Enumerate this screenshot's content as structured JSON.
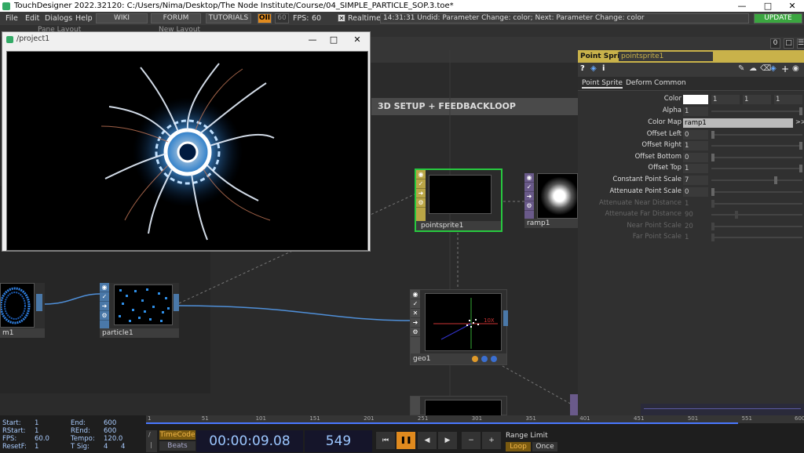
{
  "window": {
    "title": "TouchDesigner 2022.32120: C:/Users/Nima/Desktop/The Node Institute/Course/04_SIMPLE_PARTICLE_SOP.3.toe*"
  },
  "menu": {
    "items": [
      "File",
      "Edit",
      "Dialogs",
      "Help"
    ],
    "wiki": "WIKI",
    "forum": "FORUM",
    "tutorials": "TUTORIALS",
    "perf": "OII",
    "fps_target": "60",
    "fps_label": "FPS:",
    "fps_value": "60",
    "realtime": "Realtime",
    "status": "14:31:31 Undid: Parameter Change: color; Next: Parameter Change: color",
    "update": "UPDATE"
  },
  "toolbar": {
    "pane_layout": "Pane Layout",
    "new_layout": "New Layout",
    "num_zero": "0"
  },
  "floating_window": {
    "title": "/project1"
  },
  "network": {
    "annotation": "3D SETUP + FEEDBACKLOOP",
    "nodes": {
      "pointsprite": "pointsprite1",
      "ramp": "ramp1",
      "particle": "particle1",
      "circle": "m1",
      "geo": "geo1"
    },
    "geo_axis_label": "10X"
  },
  "params": {
    "type": "Point Sprite",
    "name": "pointsprite1",
    "tabs": [
      "Point Sprite",
      "Deform",
      "Common"
    ],
    "rows": [
      {
        "label": "Color",
        "value": "",
        "extra": [
          "1",
          "1",
          "1"
        ]
      },
      {
        "label": "Alpha",
        "value": "1"
      },
      {
        "label": "Color Map",
        "value": "ramp1"
      },
      {
        "label": "Offset Left",
        "value": "0"
      },
      {
        "label": "Offset Right",
        "value": "1"
      },
      {
        "label": "Offset Bottom",
        "value": "0"
      },
      {
        "label": "Offset Top",
        "value": "1"
      },
      {
        "label": "Constant Point Scale",
        "value": "7"
      },
      {
        "label": "Attenuate Point Scale",
        "value": "0"
      },
      {
        "label": "Attenuate Near Distance",
        "value": "1"
      },
      {
        "label": "Attenuate Far Distance",
        "value": "90"
      },
      {
        "label": "Near Point Scale",
        "value": "20"
      },
      {
        "label": "Far Point Scale",
        "value": "1"
      }
    ]
  },
  "timeline": {
    "start_label": "Start:",
    "start": "1",
    "rstart_label": "RStart:",
    "rstart": "1",
    "fps_label": "FPS:",
    "fps": "60.0",
    "resetf_label": "ResetF:",
    "resetf": "1",
    "end_label": "End:",
    "end": "600",
    "rend_label": "REnd:",
    "rend": "600",
    "tempo_label": "Tempo:",
    "tempo": "120.0",
    "tsig_label": "T Sig:",
    "tsig_a": "4",
    "tsig_b": "4",
    "timecode": "TimeCode",
    "beats": "Beats",
    "time": "00:00:09.08",
    "frame": "549",
    "range_limit": "Range Limit",
    "loop": "Loop",
    "once": "Once",
    "ticks": [
      "1",
      "51",
      "101",
      "151",
      "201",
      "251",
      "301",
      "351",
      "401",
      "451",
      "501",
      "551",
      "600"
    ]
  },
  "colors": {
    "accent": "#c9b24a",
    "top_node": "#6a5a8a",
    "sop_node": "#4a78a8",
    "mat_node": "#b9a546",
    "selected": "#27c93f"
  }
}
